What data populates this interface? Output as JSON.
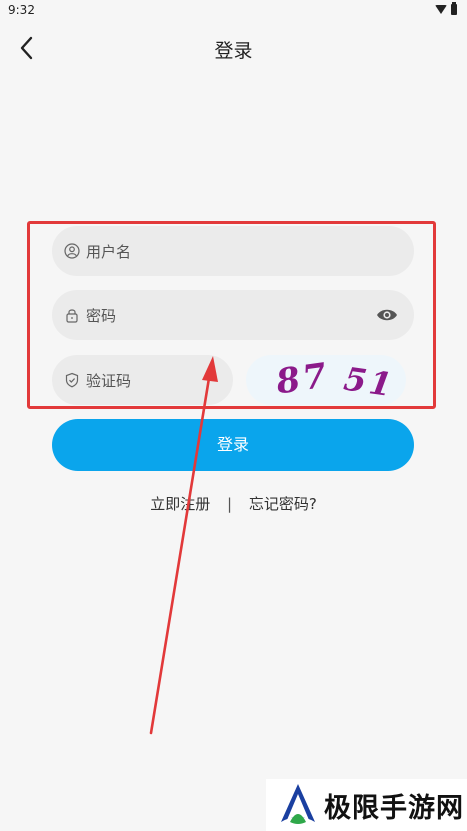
{
  "status_bar": {
    "time": "9:32"
  },
  "header": {
    "title": "登录"
  },
  "form": {
    "username_placeholder": "用户名",
    "password_placeholder": "密码",
    "captcha_placeholder": "验证码",
    "captcha_text_1": "87",
    "captcha_text_2": "51"
  },
  "login_button_label": "登录",
  "links": {
    "register": "立即注册",
    "separator": "|",
    "forgot": "忘记密码?"
  },
  "annotation_color": "#e2393a",
  "accent_color": "#0aa5ec",
  "watermark": {
    "text": "极限手游网"
  }
}
